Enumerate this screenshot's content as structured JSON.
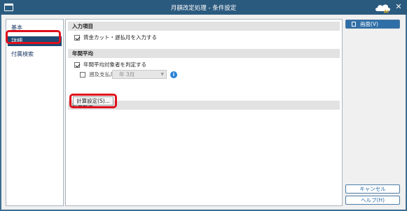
{
  "window": {
    "title": "月額改定処理 - 条件設定",
    "icons": {
      "app": "window-icon",
      "logo": "cloud-ai-logo",
      "close": "close-icon"
    },
    "logo_text": "AI",
    "close_glyph": "✕"
  },
  "nav": {
    "items": [
      {
        "label": "基本",
        "selected": false
      },
      {
        "label": "詳細",
        "selected": true
      },
      {
        "label": "付属検索",
        "selected": false
      }
    ]
  },
  "sections": {
    "input": {
      "heading": "入力項目",
      "option_label": "賃金カット・遅払月を入力する",
      "option_checked": true
    },
    "annual": {
      "heading": "年間平均",
      "option_label": "年間平均対象者を判定する",
      "option_checked": true,
      "retro_label": "遡及支払月",
      "retro_checked": false,
      "month_select_value": "年  3月",
      "info_icon": "info-icon",
      "info_glyph": "i"
    },
    "calc": {
      "heading": "計算設定",
      "button_label": "計算設定(S)..."
    }
  },
  "buttons": {
    "screen_label": "画面(V)",
    "cancel_label": "キャンセル",
    "help_label": "ヘルプ(H)"
  },
  "colors": {
    "titlebar": "#2b5a7f",
    "nav_selected": "#1f4a73",
    "primary_button": "#2f6ea6",
    "highlight": "#e0101c",
    "info": "#2a82d6"
  }
}
